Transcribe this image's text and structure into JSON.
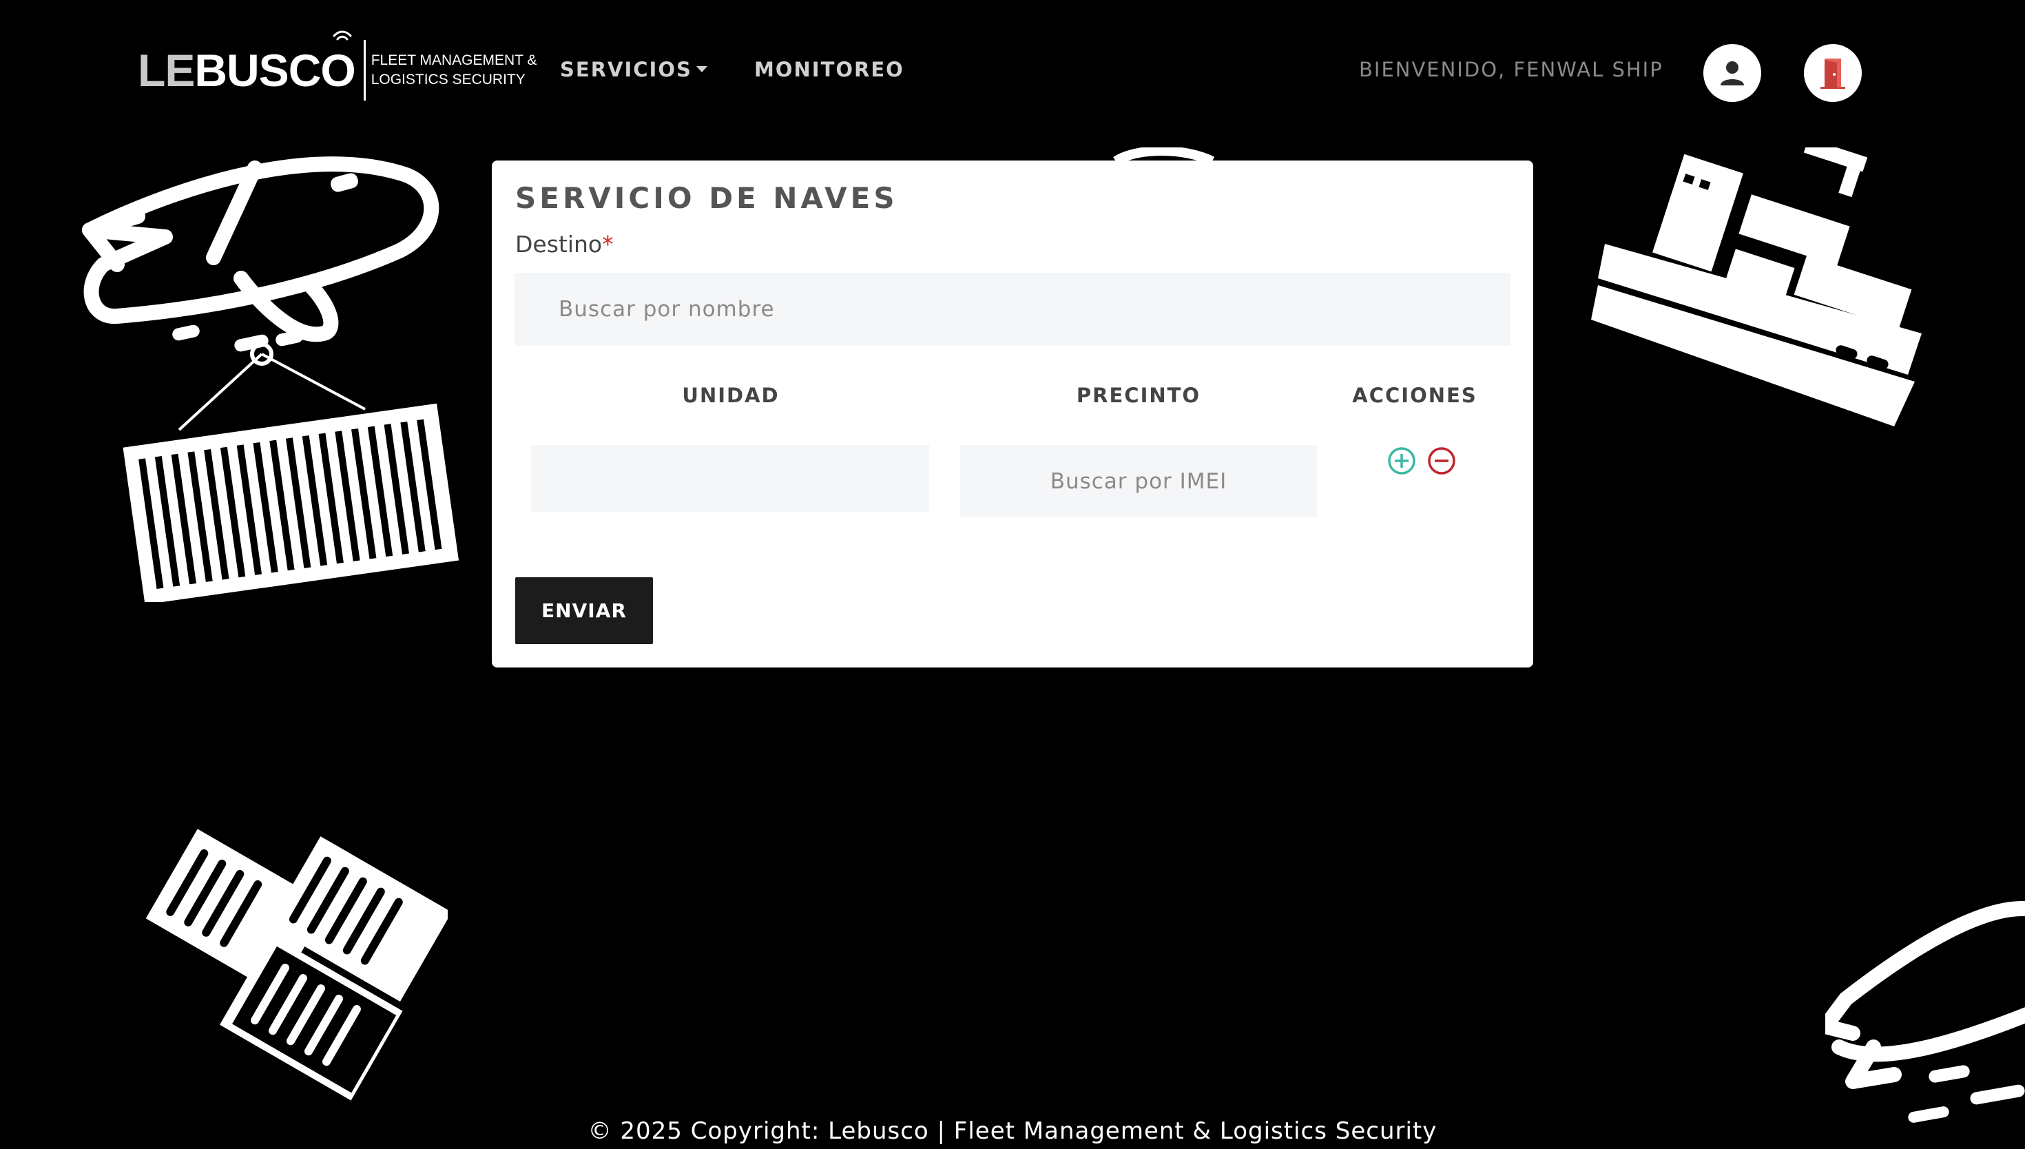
{
  "header": {
    "logo_prefix": "LE",
    "logo_suffix": "BUSCO",
    "logo_tagline": "FLEET MANAGEMENT &\nLOGISTICS SECURITY",
    "nav": {
      "services_label": "SERVICIOS",
      "monitoring_label": "MONITOREO"
    },
    "welcome_text": "BIENVENIDO, FENWAL SHIP",
    "icons": {
      "user": "user-icon",
      "logout": "door-exit-icon"
    }
  },
  "form": {
    "title": "SERVICIO DE NAVES",
    "destination_label": "Destino",
    "required_marker": "*",
    "destination_placeholder": "Buscar por nombre",
    "table": {
      "headers": [
        "UNIDAD",
        "PRECINTO",
        "ACCIONES"
      ],
      "rows": [
        {
          "unit_value": "",
          "seal_placeholder": "Buscar por IMEI"
        }
      ]
    },
    "actions": {
      "add_icon": "plus-circle-icon",
      "remove_icon": "minus-circle-icon"
    },
    "submit_label": "ENVIAR"
  },
  "colors": {
    "background": "#000000",
    "card": "#ffffff",
    "add_icon": "#3bb8a6",
    "remove_icon": "#c0242c",
    "logout_door": "#d9534f",
    "submit_button": "#1c1c1c"
  },
  "footer": {
    "text": "© 2025 Copyright: Lebusco | Fleet Management & Logistics Security"
  }
}
